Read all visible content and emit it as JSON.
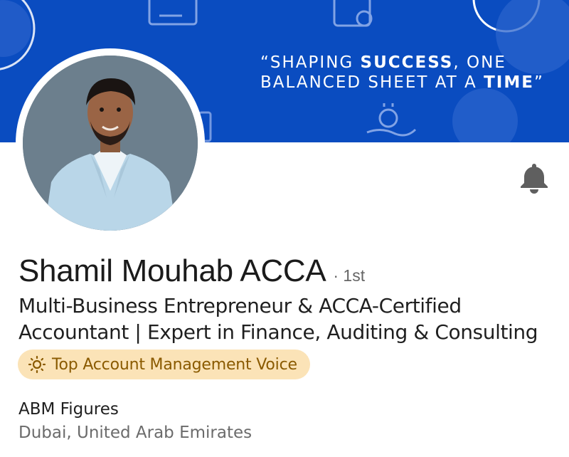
{
  "banner": {
    "quote_line1_pre": "“SHAPING ",
    "quote_line1_bold": "SUCCESS",
    "quote_line1_post": ", ONE",
    "quote_line2_pre": "BALANCED SHEET AT A ",
    "quote_line2_bold": "TIME",
    "quote_line2_post": "”",
    "background_color": "#0a4cc0"
  },
  "profile": {
    "name": "Shamil Mouhab ACCA",
    "connection_degree": "· 1st",
    "headline_line1": "Multi-Business Entrepreneur & ACCA-Certified",
    "headline_line2": "Accountant | Expert in Finance, Auditing & Consulting",
    "voice_badge": "Top Account Management Voice",
    "company": "ABM Figures",
    "location": "Dubai, United Arab Emirates"
  },
  "icons": {
    "bell": "bell-icon",
    "badge": "lightbulb-icon"
  }
}
